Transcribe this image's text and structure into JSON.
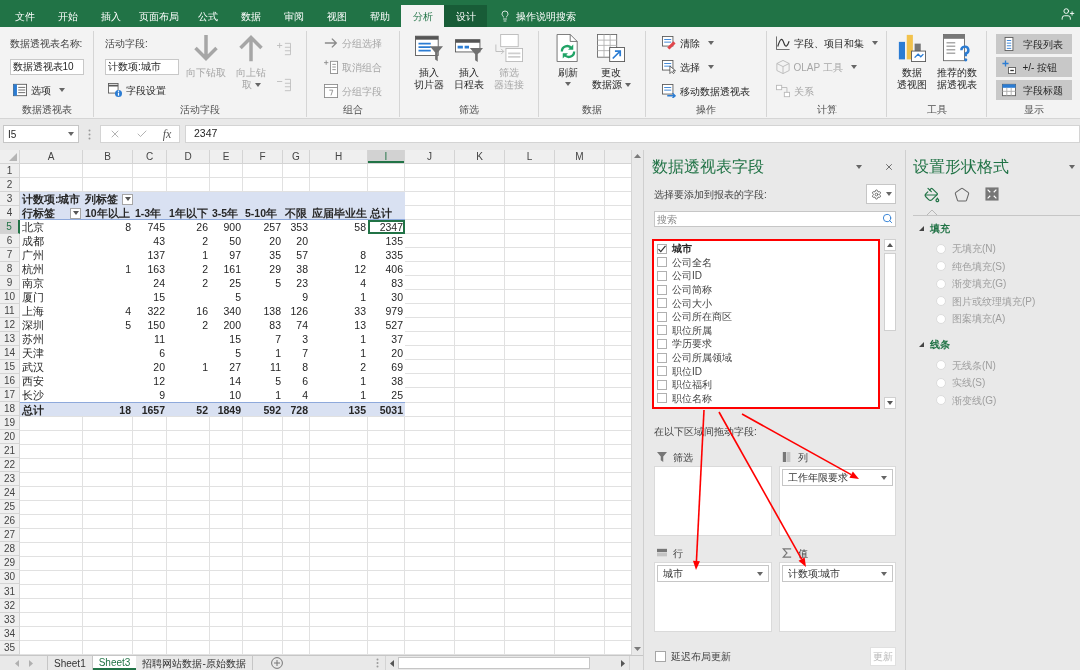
{
  "ribbon": {
    "tabs": [
      {
        "label": "文件",
        "selected": false,
        "contextual": false
      },
      {
        "label": "开始",
        "selected": false,
        "contextual": false
      },
      {
        "label": "插入",
        "selected": false,
        "contextual": false
      },
      {
        "label": "页面布局",
        "selected": false,
        "contextual": false
      },
      {
        "label": "公式",
        "selected": false,
        "contextual": false
      },
      {
        "label": "数据",
        "selected": false,
        "contextual": false
      },
      {
        "label": "审阅",
        "selected": false,
        "contextual": false
      },
      {
        "label": "视图",
        "selected": false,
        "contextual": false
      },
      {
        "label": "帮助",
        "selected": false,
        "contextual": false
      },
      {
        "label": "分析",
        "selected": true
      },
      {
        "label": "设计",
        "selected": false,
        "contextual": true
      }
    ],
    "tell_me": "操作说明搜索",
    "groups": [
      {
        "label": "数据透视表",
        "columns": [
          [
            {
              "kind": "caption",
              "label": "数据透视表名称:"
            },
            {
              "kind": "input",
              "value": "数据透视表10",
              "disabled": false
            },
            {
              "kind": "small",
              "label": "选项",
              "dropdown": true,
              "disabled": false
            }
          ]
        ]
      },
      {
        "label": "活动字段",
        "columns": [
          [
            {
              "kind": "caption",
              "label": "活动字段:"
            },
            {
              "kind": "input",
              "value": "计数项:城市",
              "disabled": false
            },
            {
              "kind": "small",
              "label": "字段设置",
              "disabled": false
            }
          ],
          [
            {
              "kind": "large",
              "lines": [
                "向下钻取"
              ],
              "disabled": true
            }
          ],
          [
            {
              "kind": "large",
              "lines": [
                "向上钻",
                "取"
              ],
              "dropdown": true,
              "disabled": true
            }
          ],
          [
            {
              "kind": "icon",
              "disabled": true
            },
            {
              "kind": "icon",
              "disabled": true
            }
          ]
        ]
      },
      {
        "label": "组合",
        "columns": [
          [
            {
              "kind": "small",
              "label": "分组选择",
              "disabled": true
            },
            {
              "kind": "small",
              "label": "取消组合",
              "disabled": true
            },
            {
              "kind": "small",
              "label": "分组字段",
              "disabled": true
            }
          ]
        ]
      },
      {
        "label": "筛选",
        "columns": [
          [
            {
              "kind": "large",
              "lines": [
                "插入",
                "切片器"
              ],
              "disabled": false
            }
          ],
          [
            {
              "kind": "large",
              "lines": [
                "插入",
                "日程表"
              ],
              "disabled": false
            }
          ],
          [
            {
              "kind": "large",
              "lines": [
                "筛选",
                "器连接"
              ],
              "disabled": true
            }
          ]
        ]
      },
      {
        "label": "数据",
        "columns": [
          [
            {
              "kind": "large",
              "lines": [
                "刷新"
              ],
              "dropdown": true,
              "disabled": false
            }
          ],
          [
            {
              "kind": "large",
              "lines": [
                "更改",
                "数据源"
              ],
              "dropdown": true,
              "disabled": false
            }
          ]
        ]
      },
      {
        "label": "操作",
        "columns": [
          [
            {
              "kind": "small",
              "label": "清除",
              "dropdown": true,
              "disabled": false
            },
            {
              "kind": "small",
              "label": "选择",
              "dropdown": true,
              "disabled": false
            },
            {
              "kind": "small",
              "label": "移动数据透视表",
              "disabled": false
            }
          ]
        ]
      },
      {
        "label": "计算",
        "columns": [
          [
            {
              "kind": "small",
              "label": "字段、项目和集",
              "dropdown": true,
              "disabled": false
            },
            {
              "kind": "small",
              "label": "OLAP 工具",
              "dropdown": true,
              "disabled": true
            },
            {
              "kind": "small",
              "label": "关系",
              "disabled": true
            }
          ]
        ]
      },
      {
        "label": "工具",
        "columns": [
          [
            {
              "kind": "large",
              "lines": [
                "数据",
                "透视图"
              ],
              "disabled": false
            }
          ],
          [
            {
              "kind": "large",
              "lines": [
                "推荐的数",
                "据透视表"
              ],
              "disabled": false
            }
          ]
        ]
      },
      {
        "label": "显示",
        "columns": [
          [
            {
              "kind": "toggle",
              "label": "字段列表",
              "on": true
            },
            {
              "kind": "toggle",
              "label": "+/- 按钮",
              "on": true
            },
            {
              "kind": "toggle",
              "label": "字段标题",
              "on": true
            }
          ]
        ]
      }
    ]
  },
  "formula_bar": {
    "name_box": "I5",
    "function_label": "fx",
    "value": "2347"
  },
  "sheet": {
    "column_headers": [
      {
        "label": "A",
        "selected": false
      },
      {
        "label": "B",
        "selected": false
      },
      {
        "label": "C",
        "selected": false
      },
      {
        "label": "D",
        "selected": false
      },
      {
        "label": "E",
        "selected": false
      },
      {
        "label": "F",
        "selected": false
      },
      {
        "label": "G",
        "selected": false
      },
      {
        "label": "H",
        "selected": false
      },
      {
        "label": "I",
        "selected": true
      },
      {
        "label": "J",
        "selected": false
      },
      {
        "label": "K",
        "selected": false
      },
      {
        "label": "L",
        "selected": false
      },
      {
        "label": "M",
        "selected": false
      }
    ],
    "row_headers": [
      {
        "label": "1",
        "selected": false
      },
      {
        "label": "2",
        "selected": false
      },
      {
        "label": "3",
        "selected": false
      },
      {
        "label": "4",
        "selected": false
      },
      {
        "label": "5",
        "selected": true
      },
      {
        "label": "6",
        "selected": false
      },
      {
        "label": "7",
        "selected": false
      },
      {
        "label": "8",
        "selected": false
      },
      {
        "label": "9",
        "selected": false
      },
      {
        "label": "10",
        "selected": false
      },
      {
        "label": "11",
        "selected": false
      },
      {
        "label": "12",
        "selected": false
      },
      {
        "label": "13",
        "selected": false
      },
      {
        "label": "14",
        "selected": false
      },
      {
        "label": "15",
        "selected": false
      },
      {
        "label": "16",
        "selected": false
      },
      {
        "label": "17",
        "selected": false
      },
      {
        "label": "18",
        "selected": false
      },
      {
        "label": "19",
        "selected": false
      },
      {
        "label": "20",
        "selected": false
      },
      {
        "label": "21",
        "selected": false
      },
      {
        "label": "22",
        "selected": false
      },
      {
        "label": "23",
        "selected": false
      },
      {
        "label": "24",
        "selected": false
      },
      {
        "label": "25",
        "selected": false
      },
      {
        "label": "26",
        "selected": false
      },
      {
        "label": "27",
        "selected": false
      },
      {
        "label": "28",
        "selected": false
      },
      {
        "label": "29",
        "selected": false
      },
      {
        "label": "30",
        "selected": false
      },
      {
        "label": "31",
        "selected": false
      },
      {
        "label": "32",
        "selected": false
      },
      {
        "label": "33",
        "selected": false
      },
      {
        "label": "34",
        "selected": false
      },
      {
        "label": "35",
        "selected": false
      }
    ],
    "pivot": {
      "title": "计数项:城市",
      "column_label": "列标签",
      "row_label": "行标签",
      "columns": [
        "10年以上",
        "1-3年",
        "1年以下",
        "3-5年",
        "5-10年",
        "不限",
        "应届毕业生",
        "总计"
      ],
      "rows": [
        {
          "label": "北京",
          "values": {
            "B": "8",
            "C": "745",
            "D": "26",
            "E": "900",
            "F": "257",
            "G": "353",
            "H": "58",
            "I": "2347"
          }
        },
        {
          "label": "成都",
          "values": {
            "C": "43",
            "D": "2",
            "E": "50",
            "F": "20",
            "G": "20",
            "I": "135"
          }
        },
        {
          "label": "广州",
          "values": {
            "C": "137",
            "D": "1",
            "E": "97",
            "F": "35",
            "G": "57",
            "H": "8",
            "I": "335"
          }
        },
        {
          "label": "杭州",
          "values": {
            "B": "1",
            "C": "163",
            "D": "2",
            "E": "161",
            "F": "29",
            "G": "38",
            "H": "12",
            "I": "406"
          }
        },
        {
          "label": "南京",
          "values": {
            "C": "24",
            "D": "2",
            "E": "25",
            "F": "5",
            "G": "23",
            "H": "4",
            "I": "83"
          }
        },
        {
          "label": "厦门",
          "values": {
            "C": "15",
            "E": "5",
            "G": "9",
            "H": "1",
            "I": "30"
          }
        },
        {
          "label": "上海",
          "values": {
            "B": "4",
            "C": "322",
            "D": "16",
            "E": "340",
            "F": "138",
            "G": "126",
            "H": "33",
            "I": "979"
          }
        },
        {
          "label": "深圳",
          "values": {
            "B": "5",
            "C": "150",
            "D": "2",
            "E": "200",
            "F": "83",
            "G": "74",
            "H": "13",
            "I": "527"
          }
        },
        {
          "label": "苏州",
          "values": {
            "C": "11",
            "E": "15",
            "F": "7",
            "G": "3",
            "H": "1",
            "I": "37"
          }
        },
        {
          "label": "天津",
          "values": {
            "C": "6",
            "E": "5",
            "F": "1",
            "G": "7",
            "H": "1",
            "I": "20"
          }
        },
        {
          "label": "武汉",
          "values": {
            "C": "20",
            "D": "1",
            "E": "27",
            "F": "11",
            "G": "8",
            "H": "2",
            "I": "69"
          }
        },
        {
          "label": "西安",
          "values": {
            "C": "12",
            "E": "14",
            "F": "5",
            "G": "6",
            "H": "1",
            "I": "38"
          }
        },
        {
          "label": "长沙",
          "values": {
            "C": "9",
            "E": "10",
            "F": "1",
            "G": "4",
            "H": "1",
            "I": "25"
          }
        }
      ],
      "total": {
        "label": "总计",
        "values": {
          "B": "18",
          "C": "1657",
          "D": "52",
          "E": "1849",
          "F": "592",
          "G": "728",
          "H": "135",
          "I": "5031"
        }
      }
    }
  },
  "sheet_tabs": [
    {
      "label": "Sheet1",
      "selected": false
    },
    {
      "label": "Sheet3",
      "selected": true
    },
    {
      "label": "招聘网站数据-原始数据",
      "selected": false
    }
  ],
  "pivot_fields_pane": {
    "title": "数据透视表字段",
    "prompt": "选择要添加到报表的字段:",
    "search": {
      "placeholder": "搜索"
    },
    "fields": [
      {
        "label": "城市",
        "checked": true
      },
      {
        "label": "公司全名",
        "checked": false
      },
      {
        "label": "公司ID",
        "checked": false
      },
      {
        "label": "公司简称",
        "checked": false
      },
      {
        "label": "公司大小",
        "checked": false
      },
      {
        "label": "公司所在商区",
        "checked": false
      },
      {
        "label": "职位所属",
        "checked": false
      },
      {
        "label": "学历要求",
        "checked": false
      },
      {
        "label": "公司所属领域",
        "checked": false
      },
      {
        "label": "职位ID",
        "checked": false
      },
      {
        "label": "职位福利",
        "checked": false
      },
      {
        "label": "职位名称",
        "checked": false
      }
    ],
    "areas_prompt": "在以下区域间拖动字段:",
    "areas": [
      {
        "kind": "filters",
        "label": "筛选"
      },
      {
        "kind": "columns",
        "label": "列",
        "items": [
          "工作年限要求"
        ]
      },
      {
        "kind": "rows",
        "label": "行",
        "items": [
          "城市"
        ]
      },
      {
        "kind": "values",
        "label": "值",
        "items": [
          "计数项:城市"
        ]
      }
    ],
    "defer_update": {
      "label": "延迟布局更新",
      "checked": false
    },
    "update_button": {
      "label": "更新",
      "disabled": true
    }
  },
  "format_pane": {
    "title": "设置形状格式",
    "tabs": [
      {
        "selected": true
      },
      {
        "selected": false
      },
      {
        "selected": false
      }
    ],
    "sections": [
      {
        "label": "填充",
        "expanded": true,
        "options": [
          {
            "label": "无填充(N)",
            "selected": false,
            "disabled": true
          },
          {
            "label": "纯色填充(S)",
            "selected": false,
            "disabled": true
          },
          {
            "label": "渐变填充(G)",
            "selected": false,
            "disabled": true
          },
          {
            "label": "图片或纹理填充(P)",
            "selected": false,
            "disabled": true
          },
          {
            "label": "图案填充(A)",
            "selected": false,
            "disabled": true
          }
        ]
      },
      {
        "label": "线条",
        "expanded": true,
        "options": [
          {
            "label": "无线条(N)",
            "selected": false,
            "disabled": true
          },
          {
            "label": "实线(S)",
            "selected": false,
            "disabled": true
          },
          {
            "label": "渐变线(G)",
            "selected": false,
            "disabled": true
          }
        ]
      }
    ]
  }
}
